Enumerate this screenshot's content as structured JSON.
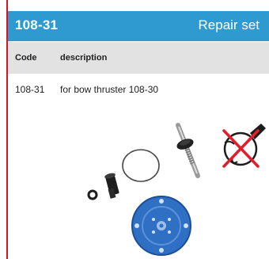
{
  "header": {
    "code": "108-31",
    "title": "Repair set"
  },
  "table": {
    "columns": [
      "Code",
      "description"
    ],
    "rows": [
      {
        "code": "108-31",
        "description": "for bow thruster 108-30"
      }
    ]
  },
  "colors": {
    "accent_red": "#d5142b",
    "header_blue": "#2f9ad0",
    "header_row_gray": "#e2e2e2",
    "part_blue": "#2f6fc4"
  },
  "icons": [
    "no-pen-icon"
  ]
}
